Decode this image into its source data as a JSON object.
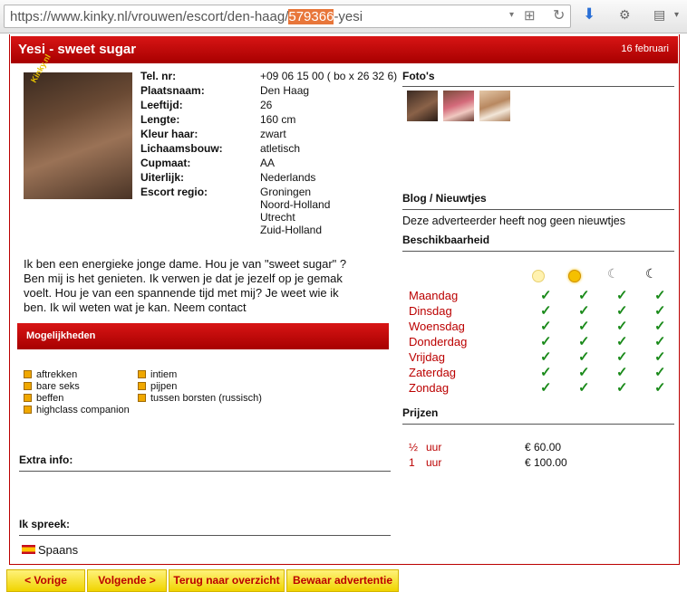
{
  "browser": {
    "url_prefix": "https://www.kinky.nl/vrouwen/escort/den-haag/",
    "url_highlight": "579366",
    "url_suffix": "-yesi"
  },
  "header": {
    "title": "Yesi - sweet sugar",
    "date": "16 februari"
  },
  "photo": {
    "watermark": "Kinky.nl"
  },
  "details": [
    {
      "label": "Tel. nr:",
      "value": "+09 06 15 00 ( bo x 26 32 6)"
    },
    {
      "label": "Plaatsnaam:",
      "value": "Den Haag"
    },
    {
      "label": "Leeftijd:",
      "value": "26"
    },
    {
      "label": "Lengte:",
      "value": "160 cm"
    },
    {
      "label": "Kleur haar:",
      "value": "zwart"
    },
    {
      "label": "Lichaamsbouw:",
      "value": "atletisch"
    },
    {
      "label": "Cupmaat:",
      "value": "AA"
    },
    {
      "label": "Uiterlijk:",
      "value": "Nederlands"
    },
    {
      "label": "Escort regio:",
      "value": "Groningen"
    }
  ],
  "regio_extra": [
    "Noord-Holland",
    "Utrecht",
    "Zuid-Holland"
  ],
  "description": [
    "Ik ben een energieke jonge dame. Hou je van \"sweet sugar\" ?",
    "Ben mij is het genieten. Ik verwen je dat je jezelf op je gemak",
    "voelt. Hou je van een spannende tijd met mij? Je weet wie ik",
    "ben. Ik wil weten wat je kan. Neem contact"
  ],
  "mogelijkheden": {
    "title": "Mogelijkheden",
    "left": [
      "aftrekken",
      "bare seks",
      "beffen",
      "highclass companion"
    ],
    "right": [
      "intiem",
      "pijpen",
      "tussen borsten (russisch)"
    ]
  },
  "extra_info": {
    "title": "Extra info:"
  },
  "languages": {
    "title": "Ik spreek:",
    "items": [
      "Spaans"
    ]
  },
  "fotos": {
    "title": "Foto's"
  },
  "blog": {
    "title": "Blog / Nieuwtjes",
    "text": "Deze adverteerder heeft nog geen nieuwtjes"
  },
  "beschikbaarheid": {
    "title": "Beschikbaarheid",
    "days": [
      "Maandag",
      "Dinsdag",
      "Woensdag",
      "Donderdag",
      "Vrijdag",
      "Zaterdag",
      "Zondag"
    ],
    "tick": "✓",
    "icons": [
      "morning-sun-icon",
      "afternoon-sun-icon",
      "evening-moon-icon",
      "night-moon-icon"
    ]
  },
  "prijzen": {
    "title": "Prijzen",
    "rows": [
      {
        "qty": "½",
        "unit": "uur",
        "price": "€ 60.00"
      },
      {
        "qty": "1",
        "unit": "uur",
        "price": "€ 100.00"
      }
    ]
  },
  "buttons": {
    "prev": "< Vorige",
    "next": "Volgende >",
    "overview": "Terug naar overzicht",
    "save": "Bewaar advertentie"
  },
  "colors": {
    "brand_red": "#c00000",
    "button_yellow": "#f5dc1e",
    "tick_green": "#1a8a1a"
  }
}
